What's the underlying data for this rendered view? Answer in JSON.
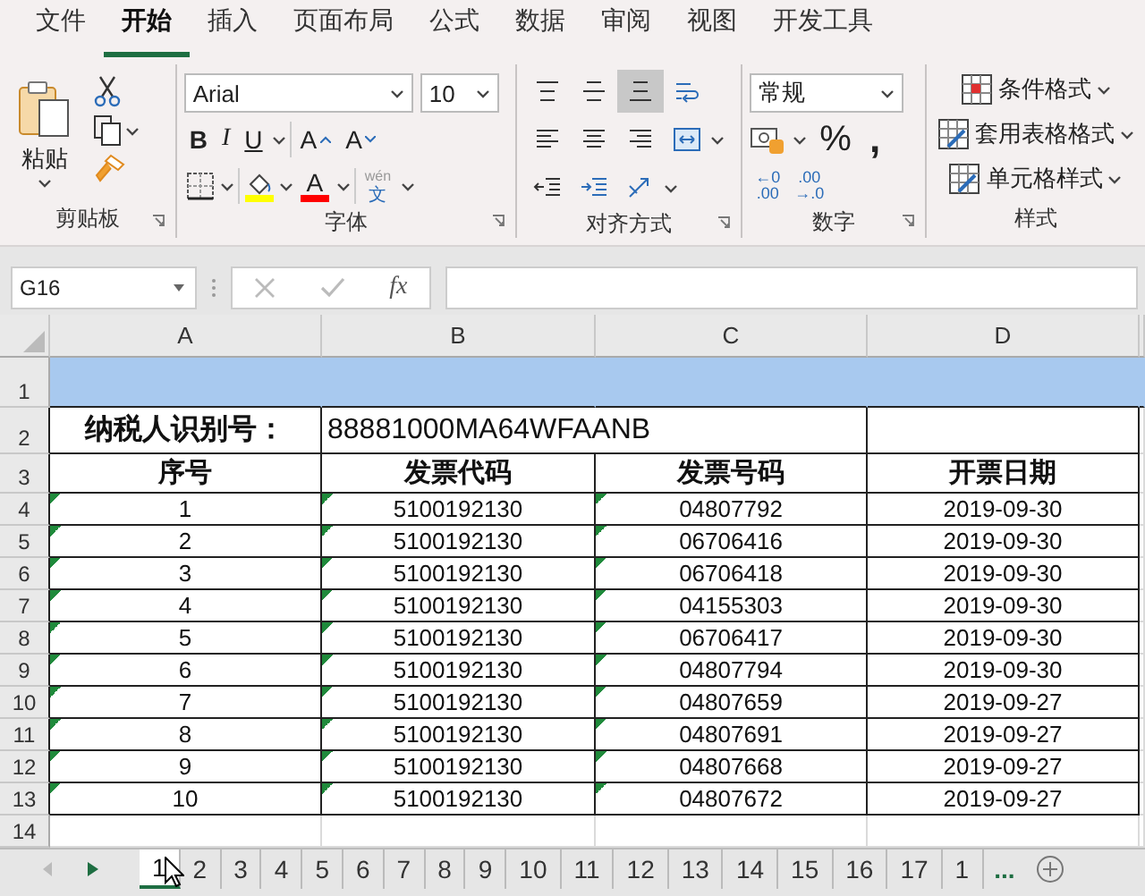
{
  "menu_tabs": [
    {
      "label": "文件",
      "selected": false
    },
    {
      "label": "开始",
      "selected": true
    },
    {
      "label": "插入",
      "selected": false
    },
    {
      "label": "页面布局",
      "selected": false
    },
    {
      "label": "公式",
      "selected": false
    },
    {
      "label": "数据",
      "selected": false
    },
    {
      "label": "审阅",
      "selected": false
    },
    {
      "label": "视图",
      "selected": false
    },
    {
      "label": "开发工具",
      "selected": false
    }
  ],
  "ribbon": {
    "clipboard": {
      "paste_label": "粘贴",
      "group_label": "剪贴板"
    },
    "font": {
      "font_name": "Arial",
      "font_size": "10",
      "bold": "B",
      "italic": "I",
      "underline": "U",
      "grow": "A",
      "shrink": "A",
      "font_color_letter": "A",
      "phonetic_top": "wén",
      "phonetic_bottom": "文",
      "group_label": "字体"
    },
    "alignment": {
      "group_label": "对齐方式",
      "buttons": [
        {
          "kind": "top",
          "selected": false
        },
        {
          "kind": "middle",
          "selected": false
        },
        {
          "kind": "bottom",
          "selected": true
        },
        {
          "kind": "wrap",
          "selected": false
        },
        {
          "kind": "left",
          "selected": false
        },
        {
          "kind": "center",
          "selected": false
        },
        {
          "kind": "right",
          "selected": false
        },
        {
          "kind": "merge",
          "selected": false
        },
        {
          "kind": "outdent",
          "selected": false
        },
        {
          "kind": "indent",
          "selected": false
        },
        {
          "kind": "orientation",
          "selected": false
        }
      ]
    },
    "number": {
      "format": "常规",
      "percent": "%",
      "comma": ",",
      "increase_decimal": [
        "←0",
        ".00"
      ],
      "decrease_decimal": [
        ".00",
        "→.0"
      ],
      "group_label": "数字"
    },
    "styles": {
      "items": [
        "条件格式",
        "套用表格格式",
        "单元格样式"
      ],
      "group_label": "样式"
    }
  },
  "formula_bar": {
    "name_box": "G16",
    "function_label": "fx"
  },
  "columns": [
    "A",
    "B",
    "C",
    "D"
  ],
  "rows": [
    {
      "number": "1",
      "kind": "banner"
    },
    {
      "number": "2",
      "kind": "taxpayer",
      "label": "纳税人识别号：",
      "value": "88881000MA64WFAANB"
    },
    {
      "number": "3",
      "kind": "header",
      "cells": [
        "序号",
        "发票代码",
        "发票号码",
        "开票日期"
      ]
    },
    {
      "number": "4",
      "kind": "data",
      "cells": [
        "1",
        "5100192130",
        "04807792",
        "2019-09-30"
      ],
      "flags": [
        true,
        true,
        true
      ]
    },
    {
      "number": "5",
      "kind": "data",
      "cells": [
        "2",
        "5100192130",
        "06706416",
        "2019-09-30"
      ],
      "flags": [
        true,
        true,
        true
      ]
    },
    {
      "number": "6",
      "kind": "data",
      "cells": [
        "3",
        "5100192130",
        "06706418",
        "2019-09-30"
      ],
      "flags": [
        true,
        true,
        true
      ]
    },
    {
      "number": "7",
      "kind": "data",
      "cells": [
        "4",
        "5100192130",
        "04155303",
        "2019-09-30"
      ],
      "flags": [
        true,
        true,
        true
      ]
    },
    {
      "number": "8",
      "kind": "data",
      "cells": [
        "5",
        "5100192130",
        "06706417",
        "2019-09-30"
      ],
      "flags": [
        true,
        true,
        true
      ]
    },
    {
      "number": "9",
      "kind": "data",
      "cells": [
        "6",
        "5100192130",
        "04807794",
        "2019-09-30"
      ],
      "flags": [
        true,
        true,
        true
      ]
    },
    {
      "number": "10",
      "kind": "data",
      "cells": [
        "7",
        "5100192130",
        "04807659",
        "2019-09-27"
      ],
      "flags": [
        true,
        true,
        true
      ]
    },
    {
      "number": "11",
      "kind": "data",
      "cells": [
        "8",
        "5100192130",
        "04807691",
        "2019-09-27"
      ],
      "flags": [
        true,
        true,
        true
      ]
    },
    {
      "number": "12",
      "kind": "data",
      "cells": [
        "9",
        "5100192130",
        "04807668",
        "2019-09-27"
      ],
      "flags": [
        true,
        true,
        true
      ]
    },
    {
      "number": "13",
      "kind": "data",
      "cells": [
        "10",
        "5100192130",
        "04807672",
        "2019-09-27"
      ],
      "flags": [
        true,
        true,
        true
      ]
    },
    {
      "number": "14",
      "kind": "empty"
    }
  ],
  "sheet_tabs": [
    {
      "label": "1",
      "selected": true
    },
    {
      "label": "2",
      "selected": false
    },
    {
      "label": "3",
      "selected": false
    },
    {
      "label": "4",
      "selected": false
    },
    {
      "label": "5",
      "selected": false
    },
    {
      "label": "6",
      "selected": false
    },
    {
      "label": "7",
      "selected": false
    },
    {
      "label": "8",
      "selected": false
    },
    {
      "label": "9",
      "selected": false
    },
    {
      "label": "10",
      "selected": false
    },
    {
      "label": "11",
      "selected": false
    },
    {
      "label": "12",
      "selected": false
    },
    {
      "label": "13",
      "selected": false
    },
    {
      "label": "14",
      "selected": false
    },
    {
      "label": "15",
      "selected": false
    },
    {
      "label": "16",
      "selected": false
    },
    {
      "label": "17",
      "selected": false
    },
    {
      "label": "1",
      "selected": false
    }
  ],
  "more_sheets": "..."
}
